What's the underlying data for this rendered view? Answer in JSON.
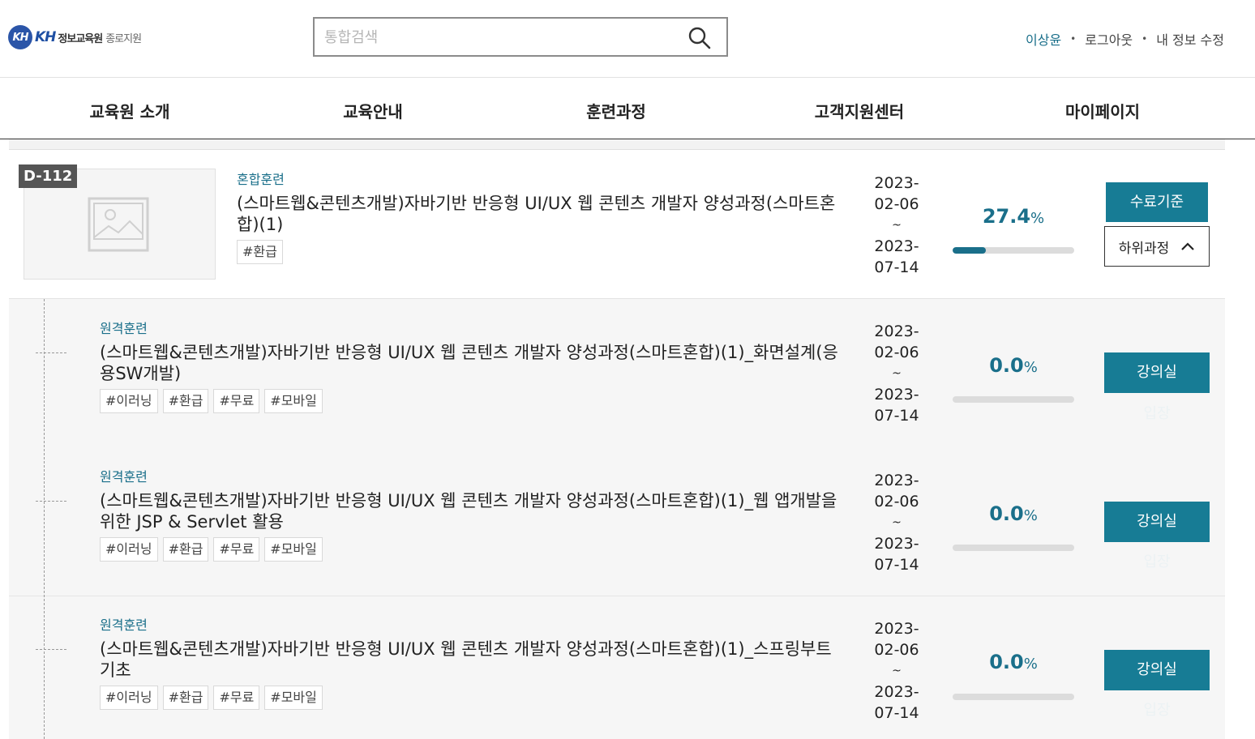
{
  "header": {
    "logo_mark": "KH",
    "logo_kh": "KH",
    "logo_name": "정보교육원",
    "logo_branch": "종로지원",
    "search_placeholder": "통합검색",
    "user": {
      "name": "이상윤",
      "logout": "로그아웃",
      "edit_profile": "내 정보 수정"
    }
  },
  "nav": {
    "items": [
      "교육원 소개",
      "교육안내",
      "훈련과정",
      "고객지원센터",
      "마이페이지"
    ]
  },
  "main_course": {
    "dday": "D-112",
    "type": "혼합훈련",
    "title": "(스마트웹&콘텐츠개발)자바기반 반응형 UI/UX 웹 콘텐츠 개발자 양성과정(스마트혼합)(1)",
    "tags": [
      "#환급"
    ],
    "start_date": "2023-\n02-06",
    "tilde": "~",
    "end_date": "2023-\n07-14",
    "progress": "27.4",
    "progress_unit": "%",
    "progress_fraction": 0.274,
    "btn_criteria": "수료기준",
    "btn_subcourses": "하위과정",
    "subcourses_icon": "chevron-up-icon"
  },
  "sub_courses": [
    {
      "type": "원격훈련",
      "title": "(스마트웹&콘텐츠개발)자바기반 반응형 UI/UX 웹 콘텐츠 개발자 양성과정(스마트혼합)(1)_화면설계(응용SW개발)",
      "tags": [
        "#이러닝",
        "#환급",
        "#무료",
        "#모바일"
      ],
      "start_date": "2023-\n02-06",
      "tilde": "~",
      "end_date": "2023-\n07-14",
      "progress": "0.0",
      "progress_unit": "%",
      "progress_fraction": 0,
      "btn_label": "강의실",
      "btn_sub": "입장"
    },
    {
      "type": "원격훈련",
      "title": "(스마트웹&콘텐츠개발)자바기반 반응형 UI/UX 웹 콘텐츠 개발자 양성과정(스마트혼합)(1)_웹 앱개발을 위한 JSP & Servlet 활용",
      "tags": [
        "#이러닝",
        "#환급",
        "#무료",
        "#모바일"
      ],
      "start_date": "2023-\n02-06",
      "tilde": "~",
      "end_date": "2023-\n07-14",
      "progress": "0.0",
      "progress_unit": "%",
      "progress_fraction": 0,
      "btn_label": "강의실",
      "btn_sub": "입장"
    },
    {
      "type": "원격훈련",
      "title": "(스마트웹&콘텐츠개발)자바기반 반응형 UI/UX 웹 콘텐츠 개발자 양성과정(스마트혼합)(1)_스프링부트 기초",
      "tags": [
        "#이러닝",
        "#환급",
        "#무료",
        "#모바일"
      ],
      "start_date": "2023-\n02-06",
      "tilde": "~",
      "end_date": "2023-\n07-14",
      "progress": "0.0",
      "progress_unit": "%",
      "progress_fraction": 0,
      "btn_label": "강의실",
      "btn_sub": "입장"
    }
  ],
  "colors": {
    "accent": "#177c95",
    "accent_text": "#1a6f8a",
    "badge_bg": "#555555",
    "sub_row_bg": "#f6f6f6"
  }
}
